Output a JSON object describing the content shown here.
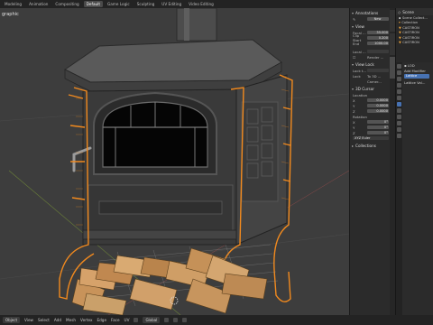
{
  "workspace_tabs": [
    "Modeling",
    "Animation",
    "Compositing",
    "Default",
    "Game Logic",
    "Sculpting",
    "UV Editing",
    "Video Editing"
  ],
  "workspace_active": "Default",
  "viewport": {
    "label": "graphic"
  },
  "npanel": {
    "annotations": {
      "header": "Annotations",
      "new_button": "New"
    },
    "view": {
      "header": "View",
      "focal_label": "Focal ...",
      "focal_value": "35.000",
      "clip_start_label": "Clip Start",
      "clip_start_value": "0.200",
      "clip_end_label": "End",
      "clip_end_value": "1000.00",
      "local_camera_label": "Local ...",
      "render_region_label": "Render ..."
    },
    "view_lock": {
      "header": "View Lock",
      "lock_to_object_label": "Lock t...",
      "lock_label": "Lock",
      "to_3d_cursor": "To 3D ...",
      "camera": "Camer..."
    },
    "cursor_3d": {
      "header": "3D Cursor",
      "location_label": "Location",
      "x_label": "X",
      "x_value": "0.0000",
      "y_label": "Y",
      "y_value": "0.0000",
      "z_label": "Z",
      "z_value": "0.0000",
      "rotation_label": "Rotation",
      "rx_label": "X",
      "rx_value": "0°",
      "ry_label": "Y",
      "ry_value": "0°",
      "rz_label": "Z",
      "rz_value": "0°",
      "euler_value": "XYZ Euler"
    },
    "collections": {
      "header": "Collections"
    }
  },
  "outliner": {
    "header": "Scene",
    "items": [
      "Scene Collect...",
      "Collection",
      "CASTIRON",
      "CASTIRON",
      "CASTIRON",
      "CASTIRON"
    ]
  },
  "properties": {
    "object_name": "LOD",
    "add_modifier": "Add Modifier",
    "lattice": "Lattice",
    "lattice_value": "Lattice Val..."
  },
  "bottombar": {
    "menus": [
      "Object",
      "View",
      "Select",
      "Add",
      "Mesh",
      "Vertex",
      "Edge",
      "Face",
      "UV"
    ],
    "transform_orientation": "Global"
  },
  "colors": {
    "viewport_bg": "#3d3d3d",
    "selection_outline": "#f28a1e",
    "accent_blue": "#4772b3",
    "stove_iron": "#3a3a3a"
  }
}
